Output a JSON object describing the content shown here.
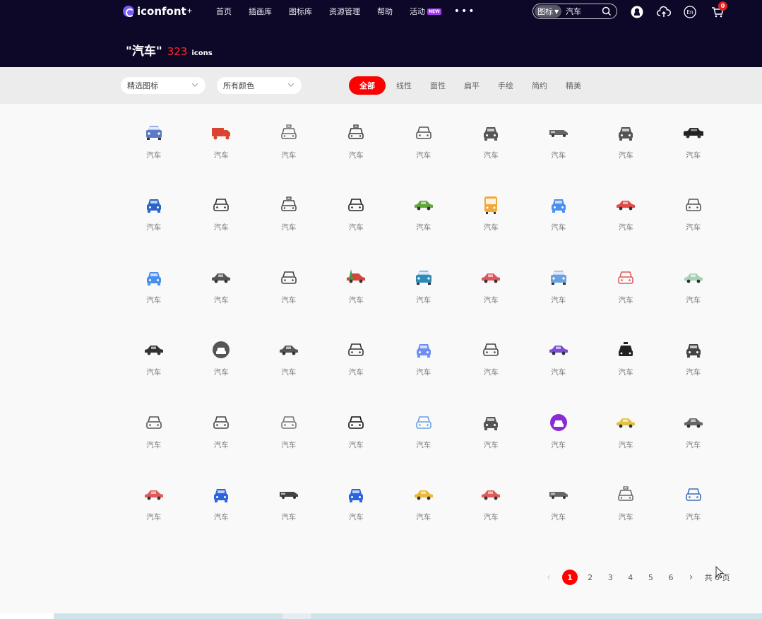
{
  "header": {
    "logo_text": "iconfont",
    "logo_sup": "+",
    "nav": [
      {
        "label": "首页"
      },
      {
        "label": "插画库"
      },
      {
        "label": "图标库"
      },
      {
        "label": "资源管理"
      },
      {
        "label": "帮助"
      },
      {
        "label": "活动",
        "badge": "NEW"
      }
    ],
    "more": "•••",
    "search": {
      "type_label": "图标",
      "value": "汽车",
      "placeholder": ""
    },
    "cart_count": "0",
    "lang_label": "En",
    "title_query": "\"汽车\"",
    "title_count": "323",
    "title_unit": "icons"
  },
  "filters": {
    "select1": "精选图标",
    "select2": "所有颜色",
    "tabs": [
      "全部",
      "线性",
      "面性",
      "扁平",
      "手绘",
      "简约",
      "精美"
    ],
    "active_tab": "全部"
  },
  "icons": [
    {
      "label": "汽车",
      "style": "flat",
      "color": "#5a7bc4"
    },
    {
      "label": "汽车",
      "style": "truck",
      "color": "#d9432f"
    },
    {
      "label": "汽车",
      "style": "taxi-outline",
      "color": "#666666"
    },
    {
      "label": "汽车",
      "style": "taxi-outline",
      "color": "#333333"
    },
    {
      "label": "汽车",
      "style": "front-outline",
      "color": "#555555"
    },
    {
      "label": "汽车",
      "style": "front-solid",
      "color": "#555555"
    },
    {
      "label": "汽车",
      "style": "van-side",
      "color": "#666666"
    },
    {
      "label": "汽车",
      "style": "front-solid",
      "color": "#555555"
    },
    {
      "label": "汽车",
      "style": "suv-side",
      "color": "#222222"
    },
    {
      "label": "汽车",
      "style": "front-solid",
      "color": "#2b63c6"
    },
    {
      "label": "汽车",
      "style": "front-outline",
      "color": "#333333"
    },
    {
      "label": "汽车",
      "style": "taxi-outline",
      "color": "#444444"
    },
    {
      "label": "汽车",
      "style": "front-outline",
      "color": "#222222"
    },
    {
      "label": "汽车",
      "style": "side",
      "color": "#5fa63c"
    },
    {
      "label": "汽车",
      "style": "bus",
      "color": "#f2a83b"
    },
    {
      "label": "汽车",
      "style": "front-solid",
      "color": "#4a8ef0"
    },
    {
      "label": "汽车",
      "style": "side",
      "color": "#e34a4a"
    },
    {
      "label": "汽车",
      "style": "front-outline",
      "color": "#555555"
    },
    {
      "label": "汽车",
      "style": "front-solid",
      "color": "#4a8ef0"
    },
    {
      "label": "汽车",
      "style": "side",
      "color": "#555555"
    },
    {
      "label": "汽车",
      "style": "front-outline",
      "color": "#444444"
    },
    {
      "label": "汽车",
      "style": "side-tree",
      "color": "#d6453b"
    },
    {
      "label": "汽车",
      "style": "flat",
      "color": "#2f8ab8"
    },
    {
      "label": "汽车",
      "style": "side",
      "color": "#e0555e"
    },
    {
      "label": "汽车",
      "style": "flat",
      "color": "#6aa2e0"
    },
    {
      "label": "汽车",
      "style": "front-outline",
      "color": "#e05a5a"
    },
    {
      "label": "汽车",
      "style": "side",
      "color": "#a9d1b6"
    },
    {
      "label": "汽车",
      "style": "side",
      "color": "#333333"
    },
    {
      "label": "汽车",
      "style": "circle",
      "color": "#555555"
    },
    {
      "label": "汽车",
      "style": "side",
      "color": "#555555"
    },
    {
      "label": "汽车",
      "style": "front-outline",
      "color": "#333333"
    },
    {
      "label": "汽车",
      "style": "front-solid",
      "color": "#6e8ff0"
    },
    {
      "label": "汽车",
      "style": "front-outline",
      "color": "#444444"
    },
    {
      "label": "汽车",
      "style": "side",
      "color": "#7b4bd6"
    },
    {
      "label": "汽车",
      "style": "taxi-solid",
      "color": "#222222"
    },
    {
      "label": "汽车",
      "style": "front-solid",
      "color": "#444444"
    },
    {
      "label": "汽车",
      "style": "front-outline",
      "color": "#555555"
    },
    {
      "label": "汽车",
      "style": "front-outline",
      "color": "#444444"
    },
    {
      "label": "汽车",
      "style": "front-outline",
      "color": "#777777"
    },
    {
      "label": "汽车",
      "style": "front-outline",
      "color": "#111111"
    },
    {
      "label": "汽车",
      "style": "front-outline",
      "color": "#6aa2e0"
    },
    {
      "label": "汽车",
      "style": "front-solid",
      "color": "#555555"
    },
    {
      "label": "汽车",
      "style": "circle",
      "color": "#8a2bd6"
    },
    {
      "label": "汽车",
      "style": "side",
      "color": "#e0c24a"
    },
    {
      "label": "汽车",
      "style": "side",
      "color": "#666666"
    },
    {
      "label": "汽车",
      "style": "side",
      "color": "#e05a5a"
    },
    {
      "label": "汽车",
      "style": "front-solid",
      "color": "#2b63e0"
    },
    {
      "label": "汽车",
      "style": "van-side",
      "color": "#444444"
    },
    {
      "label": "汽车",
      "style": "front-solid",
      "color": "#2b63e0"
    },
    {
      "label": "汽车",
      "style": "side",
      "color": "#e8b93b"
    },
    {
      "label": "汽车",
      "style": "side",
      "color": "#e05a5a"
    },
    {
      "label": "汽车",
      "style": "van-side",
      "color": "#666666"
    },
    {
      "label": "汽车",
      "style": "taxi-outline",
      "color": "#666666"
    },
    {
      "label": "汽车",
      "style": "front-outline",
      "color": "#3b6fb8"
    }
  ],
  "pagination": {
    "prev": "‹",
    "pages": [
      "1",
      "2",
      "3",
      "4",
      "5",
      "6"
    ],
    "active": "1",
    "next": "›",
    "total": "共 6 页"
  }
}
